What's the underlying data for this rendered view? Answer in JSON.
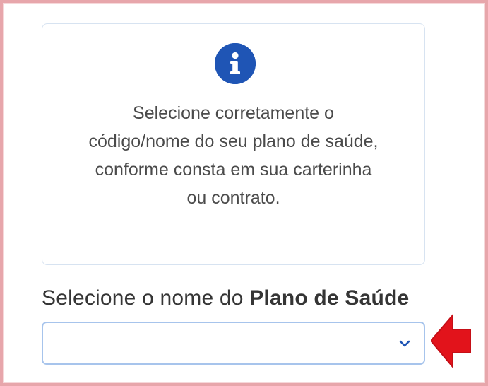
{
  "info_card": {
    "icon": "info-icon",
    "lines": [
      "Selecione corretamente o",
      "código/nome do seu plano de saúde,",
      "conforme consta em sua carterinha",
      "ou contrato."
    ]
  },
  "select": {
    "label_regular": "Selecione o nome do ",
    "label_bold": "Plano de Saúde",
    "value": "",
    "chevron_icon": "chevron-down-icon"
  },
  "annotation": {
    "arrow_icon": "left-arrow-icon",
    "arrow_color": "#e2131b"
  },
  "colors": {
    "frame_border": "#e7a6ab",
    "info_icon_bg": "#1f55b5",
    "select_border": "#a7c4ec",
    "text": "#4b4b4b"
  }
}
